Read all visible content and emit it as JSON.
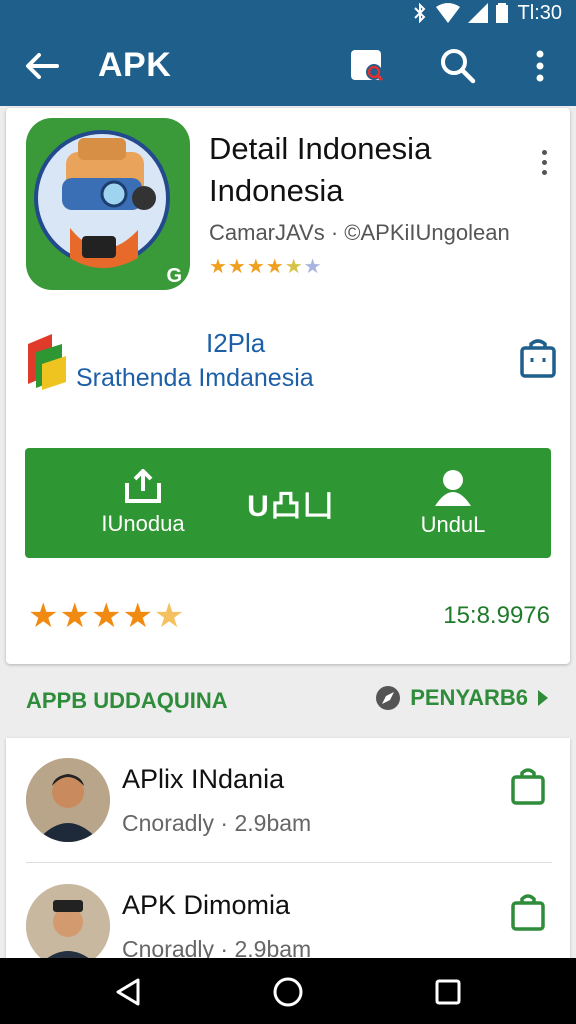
{
  "status": {
    "time": "Tl:30"
  },
  "appbar": {
    "title": "APK"
  },
  "detail": {
    "name_line1": "Detail Indonesia",
    "name_line2": "Indonesia",
    "developer": "CamarJAVs · ©APKiIUngolean",
    "rating_stars": 4.5,
    "icon_badge": "G"
  },
  "publisher": {
    "code": "I2Pla",
    "name": "Srathenda Imdanesia"
  },
  "actions": [
    {
      "label": "IUnodua"
    },
    {
      "label": "U凸凵"
    },
    {
      "label": "UnduL"
    }
  ],
  "rating": {
    "stars": 4.5,
    "count": "15:8.9976"
  },
  "section": {
    "title": "APPB UDDAQUINA",
    "more": "PENYARB6"
  },
  "list": [
    {
      "title": "APlix INdania",
      "subtitle": "Cnoradly · 2.9bam"
    },
    {
      "title": "APK Dimomia",
      "subtitle": "Cnoradly · 2.9bam"
    }
  ],
  "colors": {
    "appbar": "#1f5f8c",
    "accent": "#2e9632",
    "star": "#f08a10",
    "link": "#1d5fa8"
  }
}
